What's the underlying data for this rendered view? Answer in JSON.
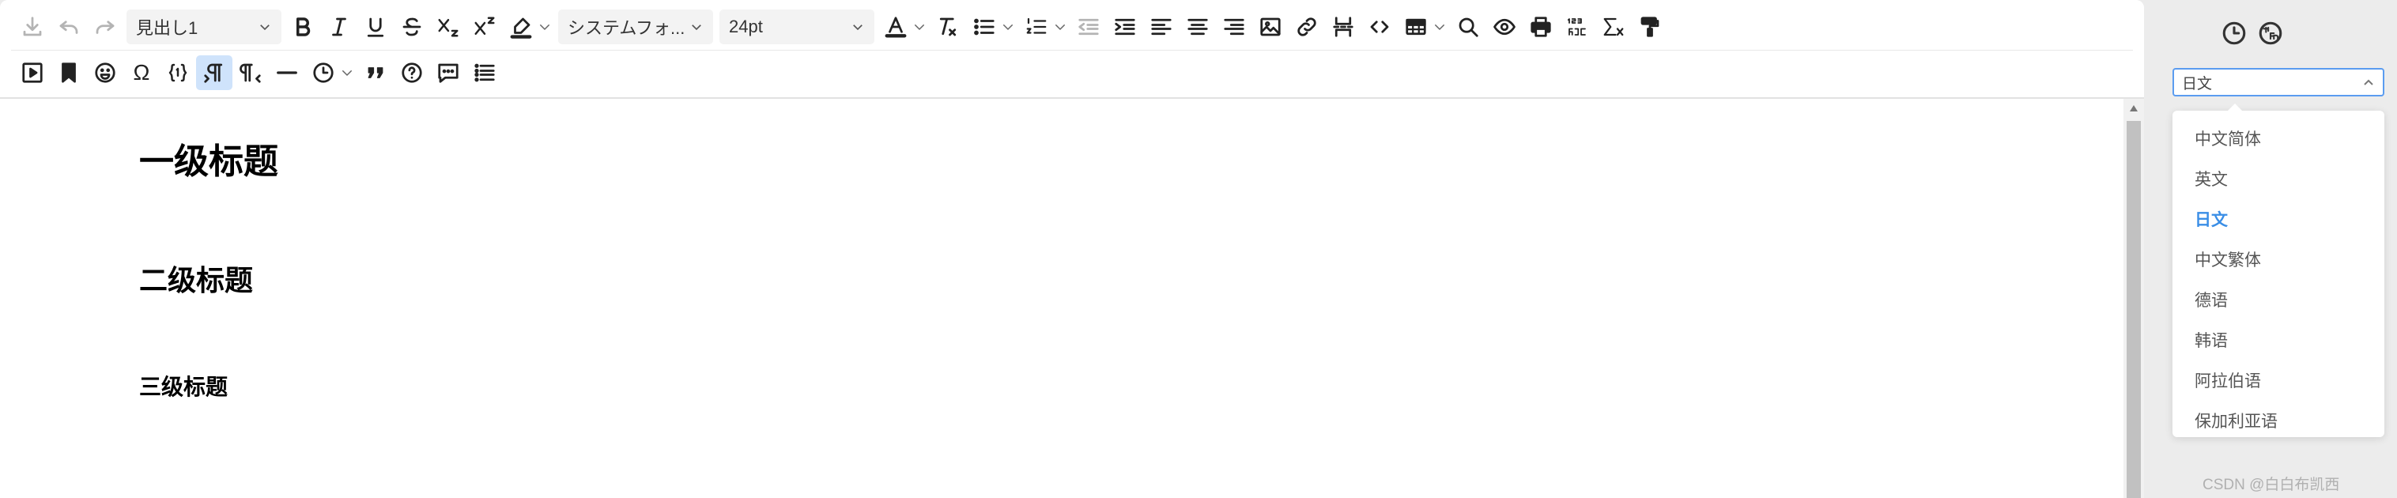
{
  "toolbar": {
    "paragraph_format": "見出し1",
    "font_family": "システムフォ...",
    "font_size": "24pt"
  },
  "content": {
    "heading1": "一级标题",
    "heading2": "二级标题",
    "heading3": "三级标题"
  },
  "side_panel": {
    "language_select_value": "日文",
    "language_options": [
      "中文简体",
      "英文",
      "日文",
      "中文繁体",
      "德语",
      "韩语",
      "阿拉伯语",
      "保加利亚语"
    ],
    "selected_language": "日文",
    "watermark": "CSDN @白白布凯西"
  },
  "icons": {
    "row1": [
      "save-icon",
      "undo-icon",
      "redo-icon",
      "bold-icon",
      "italic-icon",
      "underline-icon",
      "strikethrough-icon",
      "subscript-icon",
      "superscript-icon",
      "highlight-color-icon",
      "font-color-icon",
      "clear-format-icon",
      "bullet-list-icon",
      "numbered-list-icon",
      "outdent-icon",
      "indent-icon",
      "align-left-icon",
      "align-center-icon",
      "align-right-icon",
      "image-icon",
      "link-icon",
      "page-break-icon",
      "code-icon",
      "table-icon",
      "search-icon",
      "preview-icon",
      "print-icon",
      "spellcheck-icon",
      "formula-icon",
      "format-painter-icon"
    ],
    "row2": [
      "media-icon",
      "bookmark-icon",
      "emoji-icon",
      "special-char-icon",
      "template-icon",
      "ltr-icon",
      "rtl-icon",
      "horizontal-rule-icon",
      "insert-datetime-icon",
      "blockquote-icon",
      "help-icon",
      "comment-icon",
      "toc-icon"
    ],
    "side": [
      "history-icon",
      "translate-icon"
    ]
  },
  "colors": {
    "accent": "#3a8ee6",
    "active_button_bg": "#cfe3fb",
    "editor_bg": "#ffffff",
    "panel_bg": "#ececec"
  }
}
